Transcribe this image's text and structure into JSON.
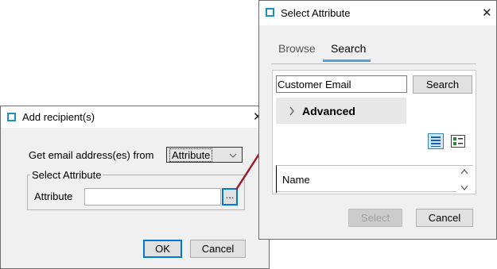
{
  "add_dialog": {
    "title": "Add recipient(s)",
    "close_glyph": "✕",
    "get_email_label": "Get email address(es) from",
    "source_select_value": "Attribute",
    "group_title": "Select Attribute",
    "attribute_label": "Attribute",
    "attribute_value": "",
    "browse_button_label": "...",
    "ok_label": "OK",
    "cancel_label": "Cancel"
  },
  "select_dialog": {
    "title": "Select Attribute",
    "close_glyph": "✕",
    "tabs": [
      {
        "label": "Browse",
        "active": false
      },
      {
        "label": "Search",
        "active": true
      }
    ],
    "search_value": "Customer Email",
    "search_button_label": "Search",
    "advanced_label": "Advanced",
    "list_header": "Name",
    "select_label": "Select",
    "cancel_label": "Cancel"
  },
  "colors": {
    "accent": "#0078d7",
    "icon_blue": "#1e90c8",
    "arrow": "#9e1b2a",
    "tab_underline": "#4fa3d8"
  }
}
